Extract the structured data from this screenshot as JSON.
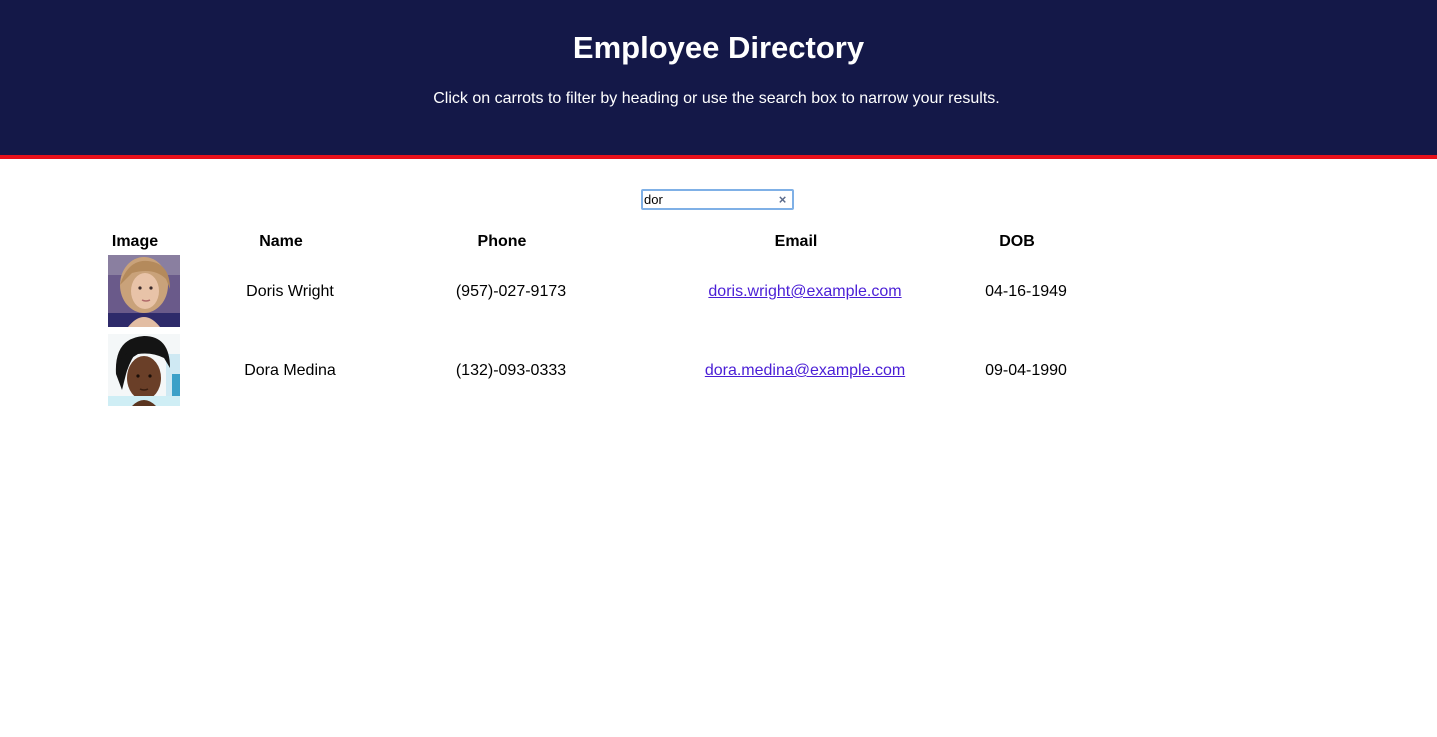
{
  "header": {
    "title": "Employee Directory",
    "subtitle": "Click on carrots to filter by heading or use the search box to narrow your results."
  },
  "search": {
    "value": "dor",
    "placeholder": "",
    "clear_glyph": "×"
  },
  "table": {
    "columns": [
      "Image",
      "Name",
      "Phone",
      "Email",
      "DOB"
    ],
    "rows": [
      {
        "name": "Doris Wright",
        "phone": "(957)-027-9173",
        "email": "doris.wright@example.com",
        "dob": "04-16-1949"
      },
      {
        "name": "Dora Medina",
        "phone": "(132)-093-0333",
        "email": "dora.medina@example.com",
        "dob": "09-04-1990"
      }
    ]
  },
  "colors": {
    "header_bg": "#141848",
    "header_border": "#e8101a",
    "link": "#4a1ed6"
  }
}
